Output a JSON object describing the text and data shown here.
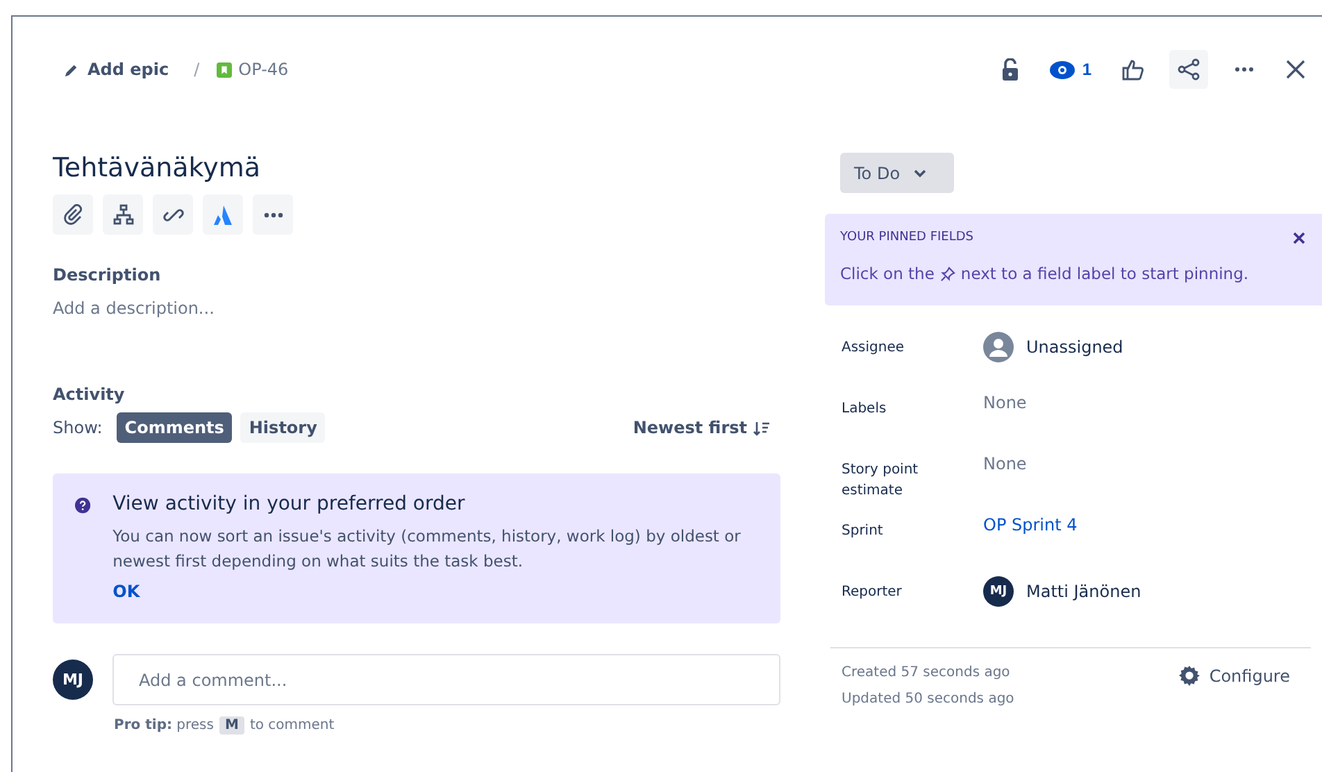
{
  "breadcrumb": {
    "epic": "Add epic",
    "separator": "/",
    "issue_key": "OP-46"
  },
  "header": {
    "watchers": "1"
  },
  "title": "Tehtävänäkymä",
  "description": {
    "label": "Description",
    "placeholder": "Add a description..."
  },
  "activity": {
    "label": "Activity",
    "show": "Show:",
    "tabs": [
      {
        "label": "Comments",
        "selected": true
      },
      {
        "label": "History",
        "selected": false
      }
    ],
    "sort": "Newest first"
  },
  "notice": {
    "title": "View activity in your preferred order",
    "body": "You can now sort an issue's activity (comments, history, work log) by oldest or newest first depending on what suits the task best.",
    "action": "OK"
  },
  "comment": {
    "avatar": "MJ",
    "placeholder": "Add a comment...",
    "tip_before": "**Pro tip:** press",
    "key": "M",
    "tip_after": "to comment"
  },
  "status": "To Do",
  "pinned": {
    "heading": "YOUR PINNED FIELDS",
    "text_before": "Click on the",
    "text_after": "next to a field label to start pinning."
  },
  "fields": [
    {
      "label": "Assignee",
      "kind": "unassigned",
      "value": "Unassigned"
    },
    {
      "label": "Labels",
      "kind": "none",
      "value": "None"
    },
    {
      "label": "Story point estimate",
      "kind": "none",
      "value": "None"
    },
    {
      "label": "Sprint",
      "kind": "link",
      "value": "OP Sprint 4"
    },
    {
      "label": "Reporter",
      "kind": "user",
      "initials": "MJ",
      "value": "Matti Jänönen"
    }
  ],
  "footer": {
    "created": "Created 57 seconds ago",
    "updated": "Updated 50 seconds ago",
    "configure": "Configure"
  }
}
